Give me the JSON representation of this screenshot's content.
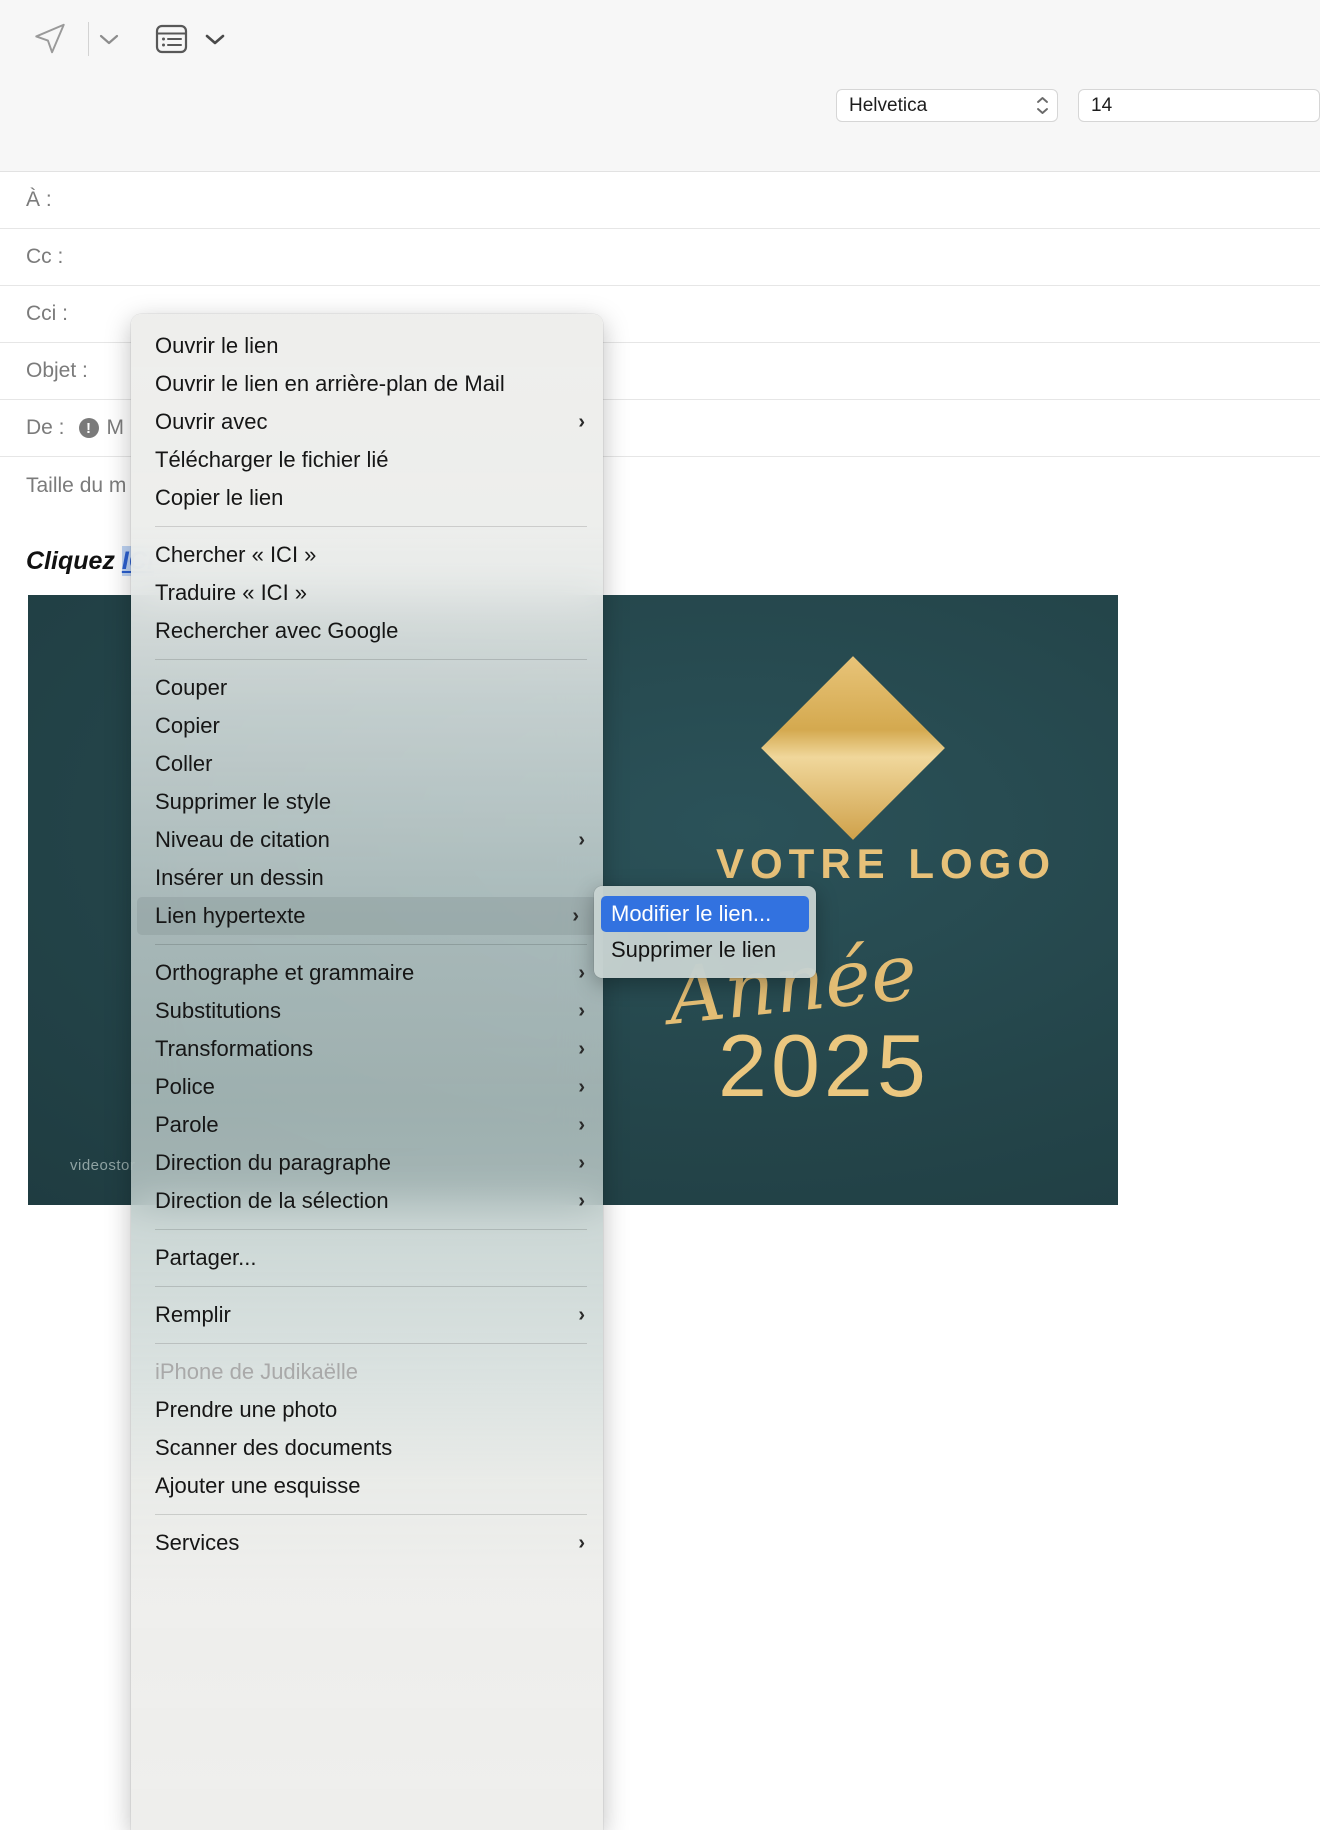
{
  "toolbar": {
    "send_icon": "send-paper-plane-icon",
    "send_chevron_icon": "chevron-down-icon",
    "template_icon": "message-template-icon",
    "template_chevron_icon": "chevron-down-icon"
  },
  "formatbar": {
    "font_family_value": "Helvetica",
    "font_family_stepper_icon": "stepper-up-down-icon",
    "font_size_value": "14"
  },
  "fields": [
    {
      "label": "À :",
      "value": ""
    },
    {
      "label": "Cc :",
      "value": ""
    },
    {
      "label": "Cci :",
      "value": ""
    },
    {
      "label": "Objet :",
      "value": ""
    },
    {
      "label": "De :",
      "value": "M",
      "has_warning": true,
      "warning_glyph": "!"
    },
    {
      "label": "Taille du m",
      "value": ""
    }
  ],
  "body": {
    "text_prefix": "Cliquez ",
    "link_text": "ICI"
  },
  "banner": {
    "logo_text": "VOTRE LOGO",
    "script_text": "Année",
    "year_text": "2025",
    "watermark": "videostor",
    "bg_color": "#24454a",
    "gold_color": "#e7c179"
  },
  "context_menu": {
    "groups": [
      {
        "items": [
          {
            "label": "Ouvrir le lien",
            "submenu": false
          },
          {
            "label": "Ouvrir le lien en arrière-plan de Mail",
            "submenu": false
          },
          {
            "label": "Ouvrir avec",
            "submenu": true
          },
          {
            "label": "Télécharger le fichier lié",
            "submenu": false
          },
          {
            "label": "Copier le lien",
            "submenu": false
          }
        ]
      },
      {
        "items": [
          {
            "label": "Chercher « ICI »",
            "submenu": false
          },
          {
            "label": "Traduire « ICI »",
            "submenu": false
          },
          {
            "label": "Rechercher avec Google",
            "submenu": false
          }
        ]
      },
      {
        "items": [
          {
            "label": "Couper",
            "submenu": false
          },
          {
            "label": "Copier",
            "submenu": false
          },
          {
            "label": "Coller",
            "submenu": false
          },
          {
            "label": "Supprimer le style",
            "submenu": false
          },
          {
            "label": "Niveau de citation",
            "submenu": true
          },
          {
            "label": "Insérer un dessin",
            "submenu": false
          },
          {
            "label": "Lien hypertexte",
            "submenu": true,
            "highlighted": true
          }
        ]
      },
      {
        "items": [
          {
            "label": "Orthographe et grammaire",
            "submenu": true
          },
          {
            "label": "Substitutions",
            "submenu": true
          },
          {
            "label": "Transformations",
            "submenu": true
          },
          {
            "label": "Police",
            "submenu": true
          },
          {
            "label": "Parole",
            "submenu": true
          },
          {
            "label": "Direction du paragraphe",
            "submenu": true
          },
          {
            "label": "Direction de la sélection",
            "submenu": true
          }
        ]
      },
      {
        "items": [
          {
            "label": "Partager...",
            "submenu": false
          }
        ]
      },
      {
        "items": [
          {
            "label": "Remplir",
            "submenu": true
          }
        ]
      },
      {
        "items": [
          {
            "label": "iPhone de Judikaëlle",
            "submenu": false,
            "disabled": true
          },
          {
            "label": "Prendre une photo",
            "submenu": false
          },
          {
            "label": "Scanner des documents",
            "submenu": false
          },
          {
            "label": "Ajouter une esquisse",
            "submenu": false
          }
        ]
      },
      {
        "items": [
          {
            "label": "Services",
            "submenu": true
          }
        ]
      }
    ],
    "arrow_glyph": "›"
  },
  "submenu": {
    "items": [
      {
        "label": "Modifier le lien...",
        "selected": true
      },
      {
        "label": "Supprimer le lien",
        "selected": false
      }
    ],
    "selected_color": "#3272e0"
  }
}
